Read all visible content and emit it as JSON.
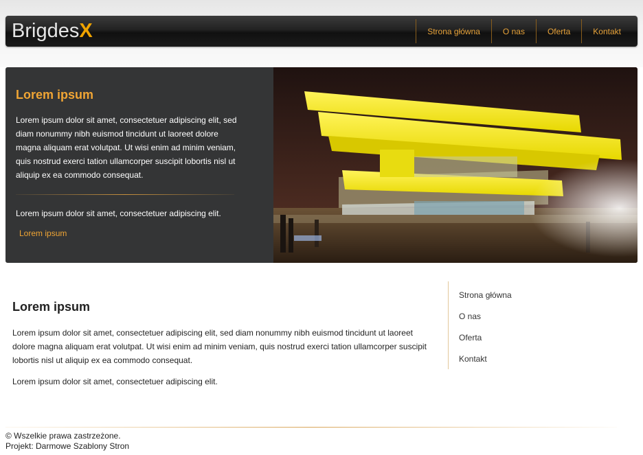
{
  "header": {
    "logo_main": "Brigdes",
    "logo_accent": "X",
    "nav": [
      "Strona główna",
      "O nas",
      "Oferta",
      "Kontakt"
    ]
  },
  "hero": {
    "title": "Lorem ipsum",
    "paragraph": "Lorem ipsum dolor sit amet, consectetuer adipiscing elit, sed diam nonummy nibh euismod tincidunt ut laoreet dolore magna aliquam erat volutpat. Ut wisi enim ad minim veniam, quis nostrud exerci tation ullamcorper suscipit lobortis nisl ut aliquip ex ea commodo consequat.",
    "paragraph2": "Lorem ipsum dolor sit amet, consectetuer adipiscing elit.",
    "link": "Lorem ipsum"
  },
  "main": {
    "title": "Lorem ipsum",
    "paragraph": "Lorem ipsum dolor sit amet, consectetuer adipiscing elit, sed diam nonummy nibh euismod tincidunt ut laoreet dolore magna aliquam erat volutpat. Ut wisi enim ad minim veniam, quis nostrud exerci tation ullamcorper suscipit lobortis nisl ut aliquip ex ea commodo consequat.",
    "paragraph2": "Lorem ipsum dolor sit amet, consectetuer adipiscing elit."
  },
  "sidebar": {
    "items": [
      "Strona główna",
      "O nas",
      "Oferta",
      "Kontakt"
    ]
  },
  "footer": {
    "copyright": "© Wszelkie prawa zastrzeżone.",
    "project": "Projekt: Darmowe Szablony Stron"
  },
  "colors": {
    "accent": "#f0a534",
    "logo_accent": "#f0a400",
    "header_bg": "#1b1b1b",
    "hero_bg": "#343536"
  }
}
